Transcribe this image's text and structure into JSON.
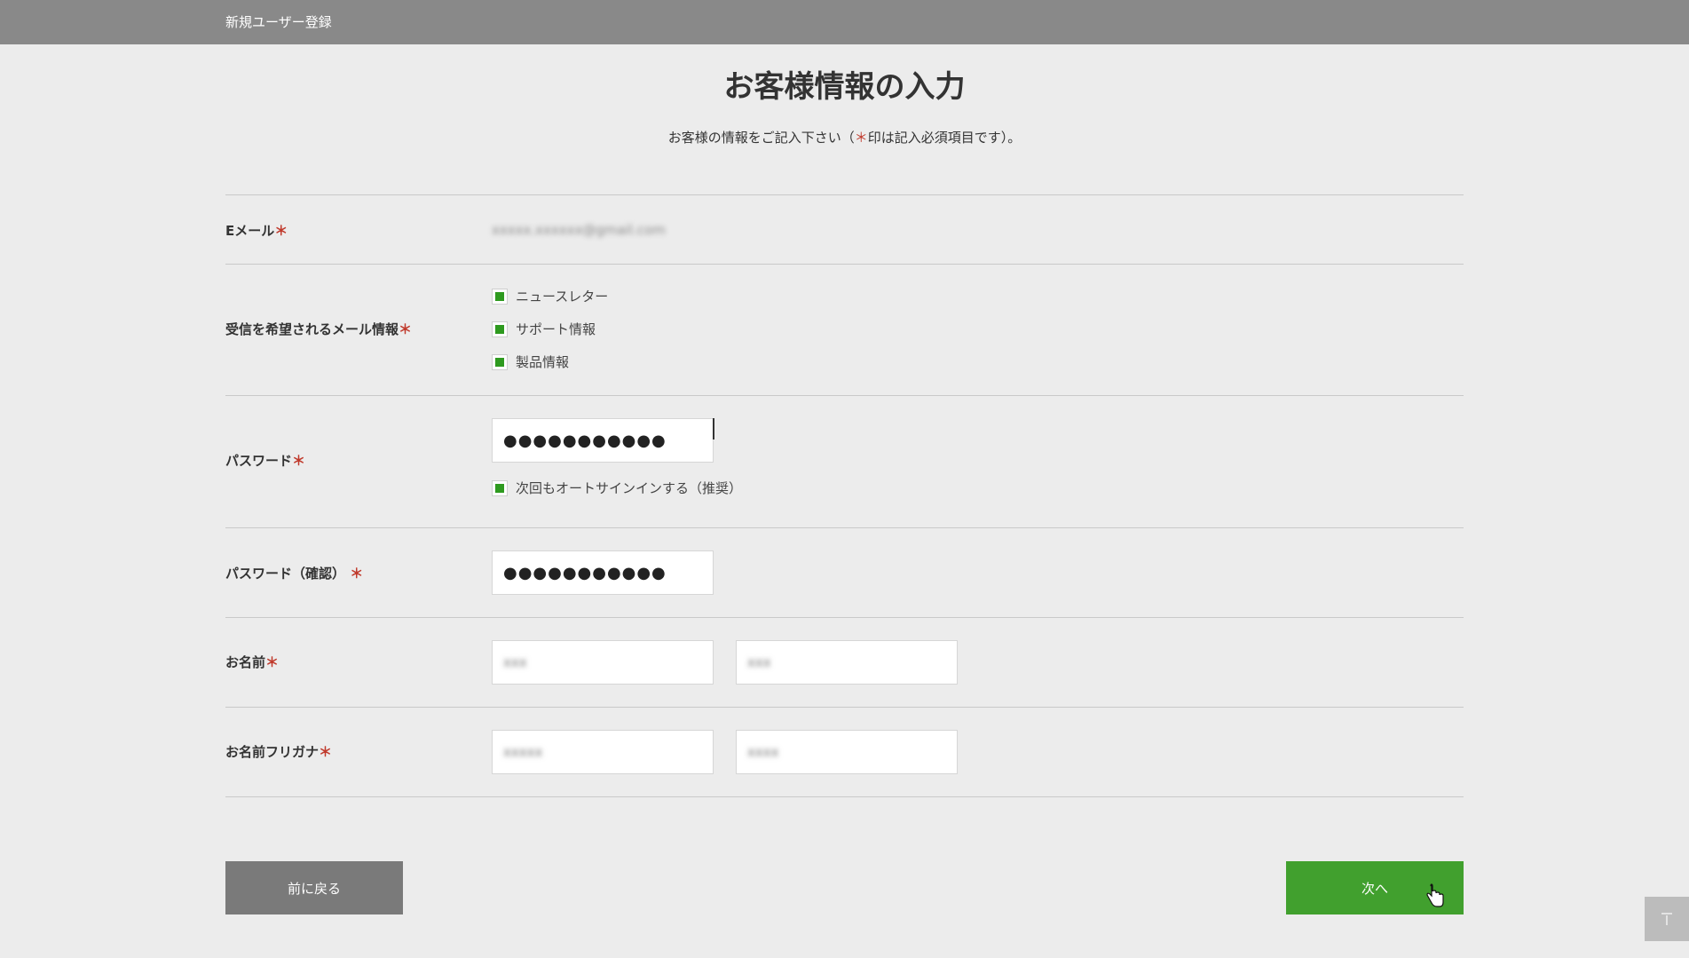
{
  "header": {
    "title": "新規ユーザー登録"
  },
  "page": {
    "heading": "お客様情報の入力",
    "subtitle_prefix": "お客様の情報をご記入下さい（",
    "subtitle_mark": "＊",
    "subtitle_suffix": "印は記入必須項目です）。"
  },
  "required_mark": "＊",
  "form": {
    "email": {
      "label": "Eメール",
      "value": "xxxxx.xxxxxx@gmail.com"
    },
    "mail_prefs": {
      "label": "受信を希望されるメール情報",
      "options": [
        {
          "label": "ニュースレター",
          "checked": true
        },
        {
          "label": "サポート情報",
          "checked": true
        },
        {
          "label": "製品情報",
          "checked": true
        }
      ]
    },
    "password": {
      "label": "パスワード",
      "value": "●●●●●●●●●●●",
      "auto_signin_label": "次回もオートサインインする（推奨）",
      "auto_signin_checked": true
    },
    "password_confirm": {
      "label": "パスワード（確認）",
      "value": "●●●●●●●●●●●"
    },
    "name": {
      "label": "お名前",
      "last": "xxx",
      "first": "xxx"
    },
    "name_kana": {
      "label": "お名前フリガナ",
      "last": "xxxxx",
      "first": "xxxx"
    }
  },
  "buttons": {
    "back": "前に戻る",
    "next": "次へ"
  },
  "icons": {
    "to_top": "arrow-to-top-icon",
    "check": "checkmark-icon"
  },
  "colors": {
    "accent": "#41a02e",
    "required": "#c0392b",
    "header_bg": "#898989"
  }
}
